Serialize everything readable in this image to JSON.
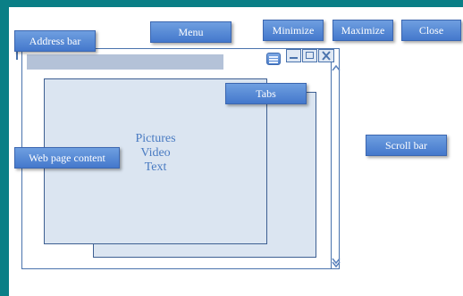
{
  "labels": {
    "address_bar": "Address bar",
    "menu": "Menu",
    "minimize": "Minimize",
    "maximize": "Maximize",
    "close": "Close",
    "tabs": "Tabs",
    "web_page_content": "Web page content",
    "scroll_bar": "Scroll bar"
  },
  "content_lines": [
    "Pictures",
    "Video",
    "Text"
  ],
  "icons": {
    "menu": "hamburger-icon",
    "minimize": "minimize-icon",
    "maximize": "maximize-icon",
    "close": "close-icon",
    "scroll_up": "chevron-up-icon",
    "scroll_down": "chevron-down-icon"
  },
  "colors": {
    "frame_background": "#0a7f86",
    "callout_fill": "#4f86d6",
    "browser_outline": "#4a73ad",
    "address_bar_fill": "#b4c2d8",
    "page_fill": "#dbe5f1",
    "content_text": "#4a7bc2"
  }
}
